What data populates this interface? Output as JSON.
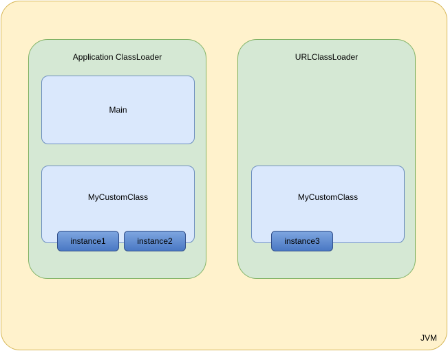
{
  "jvm": {
    "label": "JVM"
  },
  "left": {
    "title": "Application ClassLoader",
    "main": "Main",
    "custom": "MyCustomClass",
    "instance1": "instance1",
    "instance2": "instance2"
  },
  "right": {
    "title": "URLClassLoader",
    "custom": "MyCustomClass",
    "instance3": "instance3"
  }
}
